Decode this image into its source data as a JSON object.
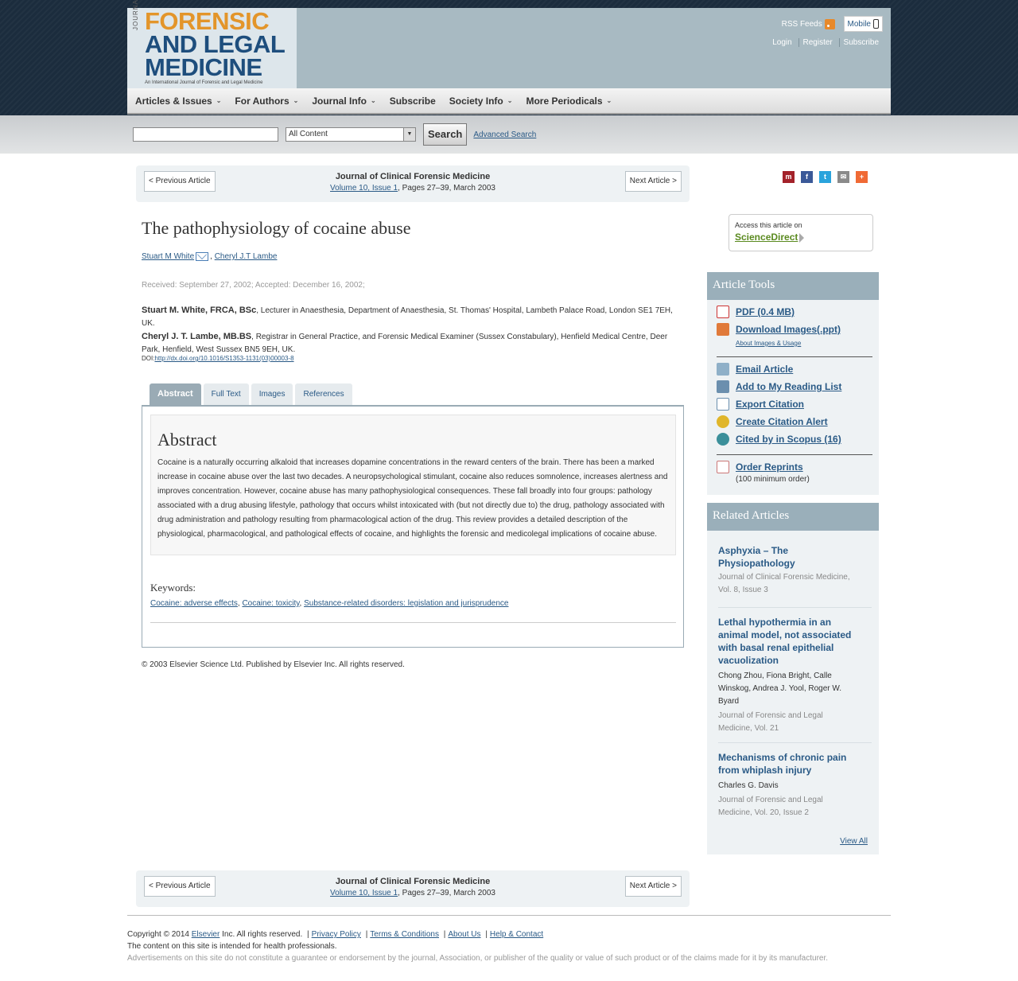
{
  "header": {
    "logo_journal_of": "JOURNAL OF",
    "logo_line1": "FORENSIC",
    "logo_line2": "AND LEGAL",
    "logo_line3": "MEDICINE",
    "logo_tagline": "An International Journal of Forensic and Legal Medicine",
    "rss_label": "RSS Feeds",
    "mobile_label": "Mobile",
    "login": "Login",
    "register": "Register",
    "subscribe": "Subscribe"
  },
  "nav": {
    "items": [
      "Articles & Issues",
      "For Authors",
      "Journal Info",
      "Subscribe",
      "Society Info",
      "More Periodicals"
    ]
  },
  "search": {
    "scope": "All Content",
    "button": "Search",
    "advanced": "Advanced Search"
  },
  "article_nav": {
    "prev": "< Previous Article",
    "next": "Next Article >",
    "journal": "Journal of Clinical Forensic Medicine",
    "volume_link": "Volume 10, Issue 1",
    "pages": ", Pages 27–39, March 2003"
  },
  "article": {
    "title": "The pathophysiology of cocaine abuse",
    "author1": "Stuart M White",
    "author2": "Cheryl J.T Lambe",
    "dates": "Received: September 27, 2002; Accepted: December 16, 2002;",
    "affil1_name": "Stuart M. White, FRCA, BSc",
    "affil1_text": ", Lecturer in Anaesthesia, Department of Anaesthesia, St. Thomas' Hospital, Lambeth Palace Road, London SE1 7EH, UK.",
    "affil2_name": "Cheryl J. T. Lambe, MB.BS",
    "affil2_text": ", Registrar in General Practice, and Forensic Medical Examiner (Sussex Constabulary), Henfield Medical Centre, Deer Park, Henfield, West Sussex BN5 9EH, UK.",
    "doi_label": "DOI:",
    "doi_link": "http://dx.doi.org/10.1016/S1353-1131(03)00003-8"
  },
  "tabs": [
    "Abstract",
    "Full Text",
    "Images",
    "References"
  ],
  "abstract": {
    "heading": "Abstract",
    "text": "Cocaine is a naturally occurring alkaloid that increases dopamine concentrations in the reward centers of the brain. There has been a marked increase in cocaine abuse over the last two decades. A neuropsychological stimulant, cocaine also reduces somnolence, increases alertness and improves concentration. However, cocaine abuse has many pathophysiological consequences. These fall broadly into four groups: pathology associated with a drug abusing lifestyle, pathology that occurs whilst intoxicated with (but not directly due to) the drug, pathology associated with drug administration and pathology resulting from pharmacological action of the drug. This review provides a detailed description of the physiological, pharmacological, and pathological effects of cocaine, and highlights the forensic and medicolegal implications of cocaine abuse.",
    "keywords_heading": "Keywords:",
    "keywords": [
      "Cocaine: adverse effects",
      "Cocaine: toxicity",
      "Substance-related disorders: legislation and jurisprudence"
    ]
  },
  "copyright": "© 2003 Elsevier Science Ltd. Published by Elsevier Inc. All rights reserved.",
  "sciencedirect": {
    "access_text": "Access this article on",
    "link": "ScienceDirect"
  },
  "article_tools": {
    "heading": "Article Tools",
    "pdf": "PDF (0.4 MB)",
    "download_images": "Download Images(.ppt)",
    "about_images": "About Images & Usage",
    "email": "Email Article",
    "reading_list": "Add to My Reading List",
    "export": "Export Citation",
    "alert": "Create Citation Alert",
    "scopus": "Cited by in Scopus (16)",
    "reprints": "Order Reprints",
    "reprints_note": "(100 minimum order)"
  },
  "related": {
    "heading": "Related Articles",
    "items": [
      {
        "title": "Asphyxia – The Physiopathology",
        "authors": "",
        "source": "Journal of Clinical Forensic Medicine, Vol. 8, Issue 3"
      },
      {
        "title": "Lethal hypothermia in an animal model, not associated with basal renal epithelial vacuolization",
        "authors": "Chong Zhou, Fiona Bright, Calle Winskog, Andrea J. Yool, Roger W. Byard",
        "source": "Journal of Forensic and Legal Medicine, Vol. 21"
      },
      {
        "title": "Mechanisms of chronic pain from whiplash injury",
        "authors": "Charles G. Davis",
        "source": "Journal of Forensic and Legal Medicine, Vol. 20, Issue 2"
      }
    ],
    "view_all": "View All"
  },
  "footer": {
    "copyright_prefix": "Copyright © 2014",
    "elsevier": "Elsevier",
    "rights": "Inc. All rights reserved.",
    "privacy": "Privacy Policy",
    "terms": "Terms & Conditions",
    "about": "About Us",
    "help": "Help & Contact",
    "line2": "The content on this site is intended for health professionals.",
    "line3": "Advertisements on this site do not constitute a guarantee or endorsement by the journal, Association, or publisher of the quality or value of such product or of the claims made for it by its manufacturer."
  },
  "colors": {
    "header_bg": "#a8bac2",
    "link": "#2a5a86",
    "logo_orange": "#e3952a",
    "logo_blue": "#1e4e7d",
    "panel_header": "#9aafba",
    "sciencedirect_green": "#5a8a1f"
  },
  "icons": {
    "share": [
      "mendeley-icon",
      "facebook-icon",
      "twitter-icon",
      "email-icon",
      "addthis-icon"
    ]
  }
}
